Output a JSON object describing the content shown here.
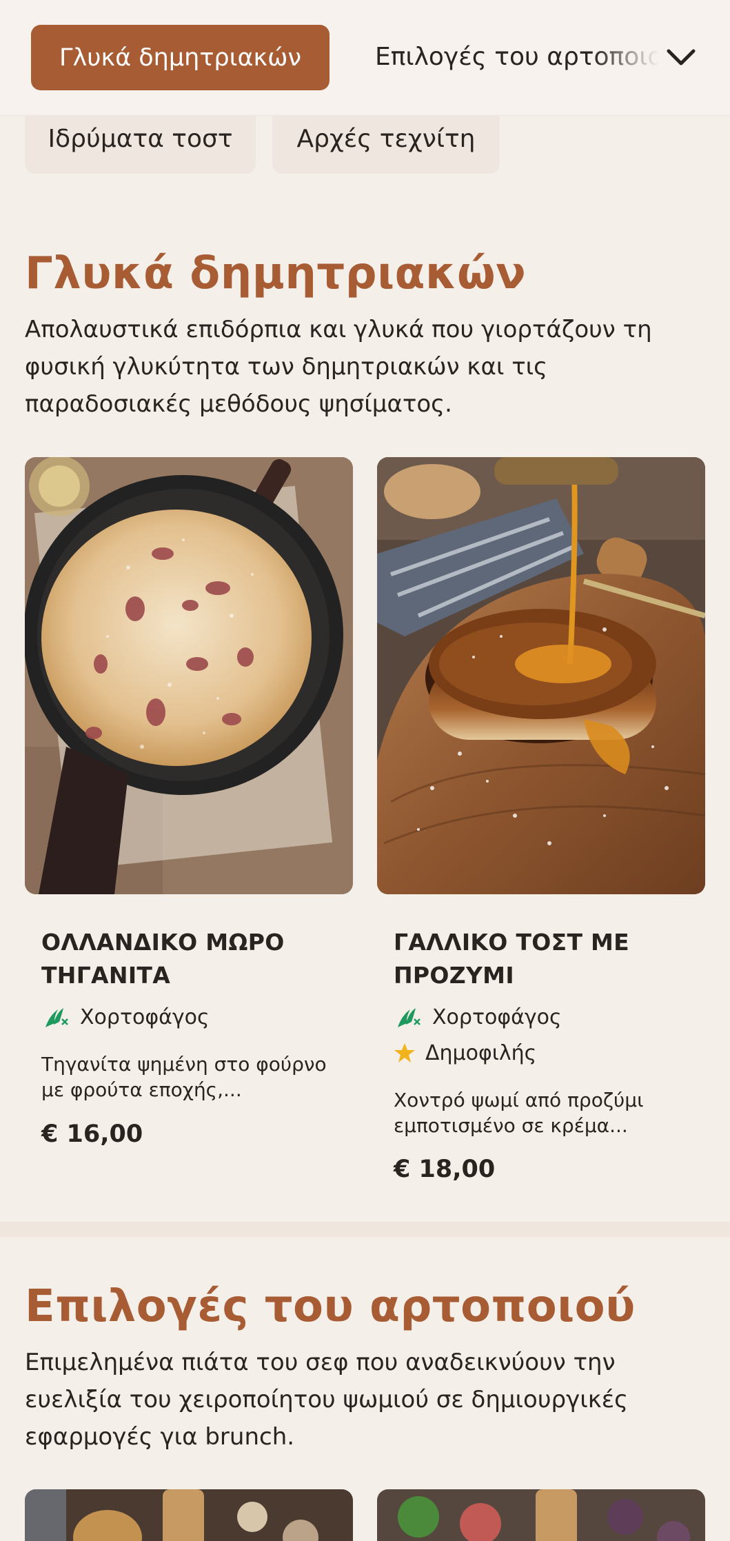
{
  "nav": {
    "active_tab": "Γλυκά δημητριακών",
    "next_tab": "Επιλογές του αρτοποιού",
    "chevron_icon": "chevron-down-icon",
    "sub_tabs": [
      "Ιδρύματα τοστ",
      "Αρχές τεχνίτη"
    ]
  },
  "colors": {
    "accent": "#a85c34",
    "background": "#f5efea",
    "vegetarian_green": "#1f9a5e",
    "star_yellow": "#f2b21c"
  },
  "sections": [
    {
      "title": "Γλυκά δημητριακών",
      "description": "Απολαυστικά επιδόρπια και γλυκά που γιορτάζουν τη φυσική γλυκύτητα των δημητριακών και τις παραδοσιακές μεθόδους ψησίματος.",
      "items": [
        {
          "name": "ΟΛΛΑΝΔΙΚΟ ΜΩΡΟ ΤΗΓΑΝΙΤΑ",
          "badges": [
            {
              "icon": "vegetarian-icon",
              "label": "Χορτοφάγος"
            }
          ],
          "description": "Τηγανίτα ψημένη στο φούρνο με φρούτα εποχής,...",
          "price": "€ 16,00"
        },
        {
          "name": "ΓΑΛΛΙΚΟ ΤΟΣΤ ΜΕ ΠΡΟΖΥΜΙ",
          "badges": [
            {
              "icon": "vegetarian-icon",
              "label": "Χορτοφάγος"
            },
            {
              "icon": "star-icon",
              "label": "Δημοφιλής"
            }
          ],
          "description": "Χοντρό ψωμί από προζύμι εμποτισμένο σε κρέμα...",
          "price": "€ 18,00"
        }
      ]
    },
    {
      "title": "Επιλογές του αρτοποιού",
      "description": "Επιμελημένα πιάτα του σεφ που αναδεικνύουν την ευελιξία του χειροποίητου ψωμιού σε δημιουργικές εφαρμογές για brunch."
    }
  ]
}
